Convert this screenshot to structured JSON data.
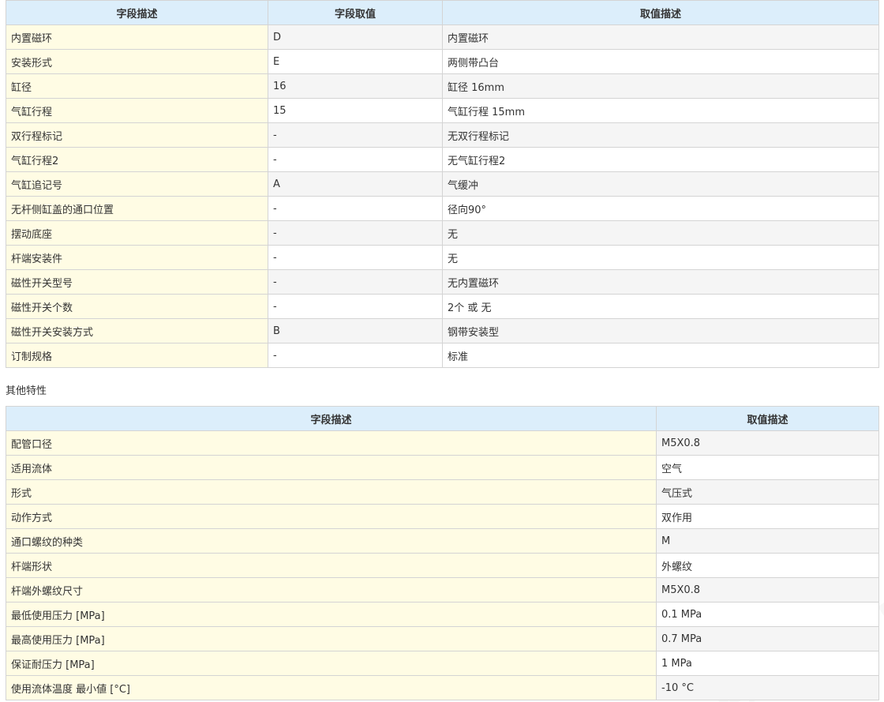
{
  "table1": {
    "headers": [
      "字段描述",
      "字段取值",
      "取值描述"
    ],
    "rows": [
      [
        "内置磁环",
        "D",
        "内置磁环"
      ],
      [
        "安装形式",
        "E",
        "两侧带凸台"
      ],
      [
        "缸径",
        "16",
        "缸径 16mm"
      ],
      [
        "气缸行程",
        "15",
        "气缸行程 15mm"
      ],
      [
        "双行程标记",
        "-",
        "无双行程标记"
      ],
      [
        "气缸行程2",
        "-",
        "无气缸行程2"
      ],
      [
        "气缸追记号",
        "A",
        "气缓冲"
      ],
      [
        "无杆侧缸盖的通口位置",
        "-",
        "径向90°"
      ],
      [
        "摆动底座",
        "-",
        "无"
      ],
      [
        "杆端安装件",
        "-",
        "无"
      ],
      [
        "磁性开关型号",
        "-",
        "无内置磁环"
      ],
      [
        "磁性开关个数",
        "-",
        "2个 或 无"
      ],
      [
        "磁性开关安装方式",
        "B",
        "钢带安装型"
      ],
      [
        "订制规格",
        "-",
        "标准"
      ]
    ]
  },
  "section_label": "其他特性",
  "table2": {
    "headers": [
      "字段描述",
      "取值描述"
    ],
    "rows": [
      [
        "配管口径",
        "M5X0.8"
      ],
      [
        "适用流体",
        "空气"
      ],
      [
        "形式",
        "气压式"
      ],
      [
        "动作方式",
        "双作用"
      ],
      [
        "通口螺纹的种类",
        "M"
      ],
      [
        "杆端形状",
        "外螺纹"
      ],
      [
        "杆端外螺纹尺寸",
        "M5X0.8"
      ],
      [
        "最低使用压力 [MPa]",
        "0.1 MPa"
      ],
      [
        "最高使用压力 [MPa]",
        "0.7 MPa"
      ],
      [
        "保证耐压力 [MPa]",
        "1 MPa"
      ],
      [
        "使用流体温度 最小値 [°C]",
        "-10 °C"
      ]
    ]
  },
  "watermark": "em17.com",
  "colors": {
    "header_bg": "#dceefb",
    "key_col_bg": "#fffce4",
    "alt_row_bg": "#f5f5f5",
    "border": "#d4d4d4"
  }
}
